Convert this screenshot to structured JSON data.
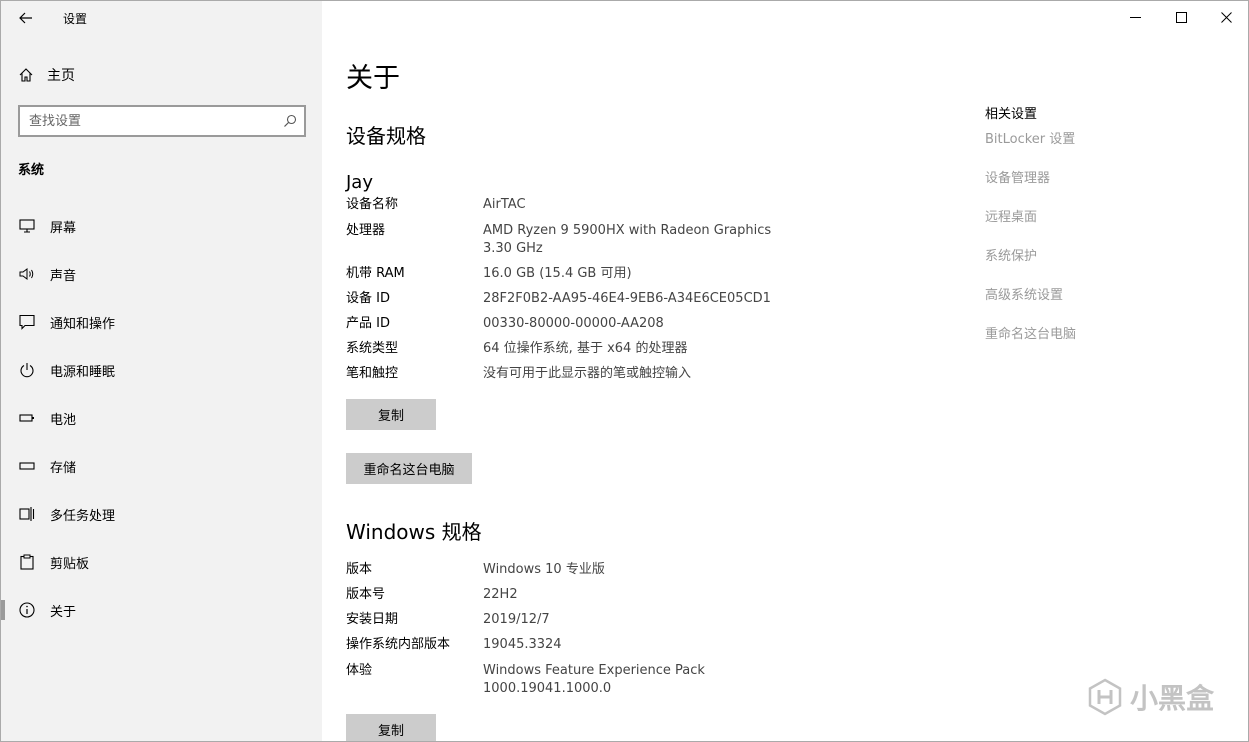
{
  "window": {
    "app_title": "设置"
  },
  "sidebar": {
    "home_label": "主页",
    "search_placeholder": "查找设置",
    "section_title": "系统",
    "items": [
      {
        "label": "屏幕",
        "icon": "monitor-icon"
      },
      {
        "label": "声音",
        "icon": "speaker-icon"
      },
      {
        "label": "通知和操作",
        "icon": "notification-icon"
      },
      {
        "label": "电源和睡眠",
        "icon": "power-icon"
      },
      {
        "label": "电池",
        "icon": "battery-icon"
      },
      {
        "label": "存储",
        "icon": "storage-icon"
      },
      {
        "label": "多任务处理",
        "icon": "multitasking-icon"
      },
      {
        "label": "剪贴板",
        "icon": "clipboard-icon"
      },
      {
        "label": "关于",
        "icon": "info-icon",
        "active": true
      }
    ]
  },
  "main": {
    "page_title": "关于",
    "device_specs_title": "设备规格",
    "device_name": "Jay",
    "device_specs": [
      {
        "key": "设备名称",
        "value": "AirTAC"
      },
      {
        "key": "处理器",
        "value": "AMD Ryzen 9 5900HX with Radeon Graphics\n3.30 GHz"
      },
      {
        "key": "机带 RAM",
        "value": "16.0 GB (15.4 GB 可用)"
      },
      {
        "key": "设备 ID",
        "value": "28F2F0B2-AA95-46E4-9EB6-A34E6CE05CD1"
      },
      {
        "key": "产品 ID",
        "value": "00330-80000-00000-AA208"
      },
      {
        "key": "系统类型",
        "value": "64 位操作系统, 基于 x64 的处理器"
      },
      {
        "key": "笔和触控",
        "value": "没有可用于此显示器的笔或触控输入"
      }
    ],
    "copy_label": "复制",
    "rename_label": "重命名这台电脑",
    "windows_specs_title": "Windows 规格",
    "windows_specs": [
      {
        "key": "版本",
        "value": "Windows 10 专业版"
      },
      {
        "key": "版本号",
        "value": "22H2"
      },
      {
        "key": "安装日期",
        "value": "2019/12/7"
      },
      {
        "key": "操作系统内部版本",
        "value": "19045.3324"
      },
      {
        "key": "体验",
        "value": "Windows Feature Experience Pack\n1000.19041.1000.0"
      }
    ],
    "copy2_label": "复制"
  },
  "related": {
    "title": "相关设置",
    "links": [
      "BitLocker 设置",
      "设备管理器",
      "远程桌面",
      "系统保护",
      "高级系统设置",
      "重命名这台电脑"
    ]
  },
  "watermark": {
    "text": "小黑盒"
  },
  "colors": {
    "sidebar_bg": "#f2f2f2",
    "button_bg": "#cccccc",
    "link_disabled": "#9a9a9a",
    "value_text": "#444444"
  }
}
